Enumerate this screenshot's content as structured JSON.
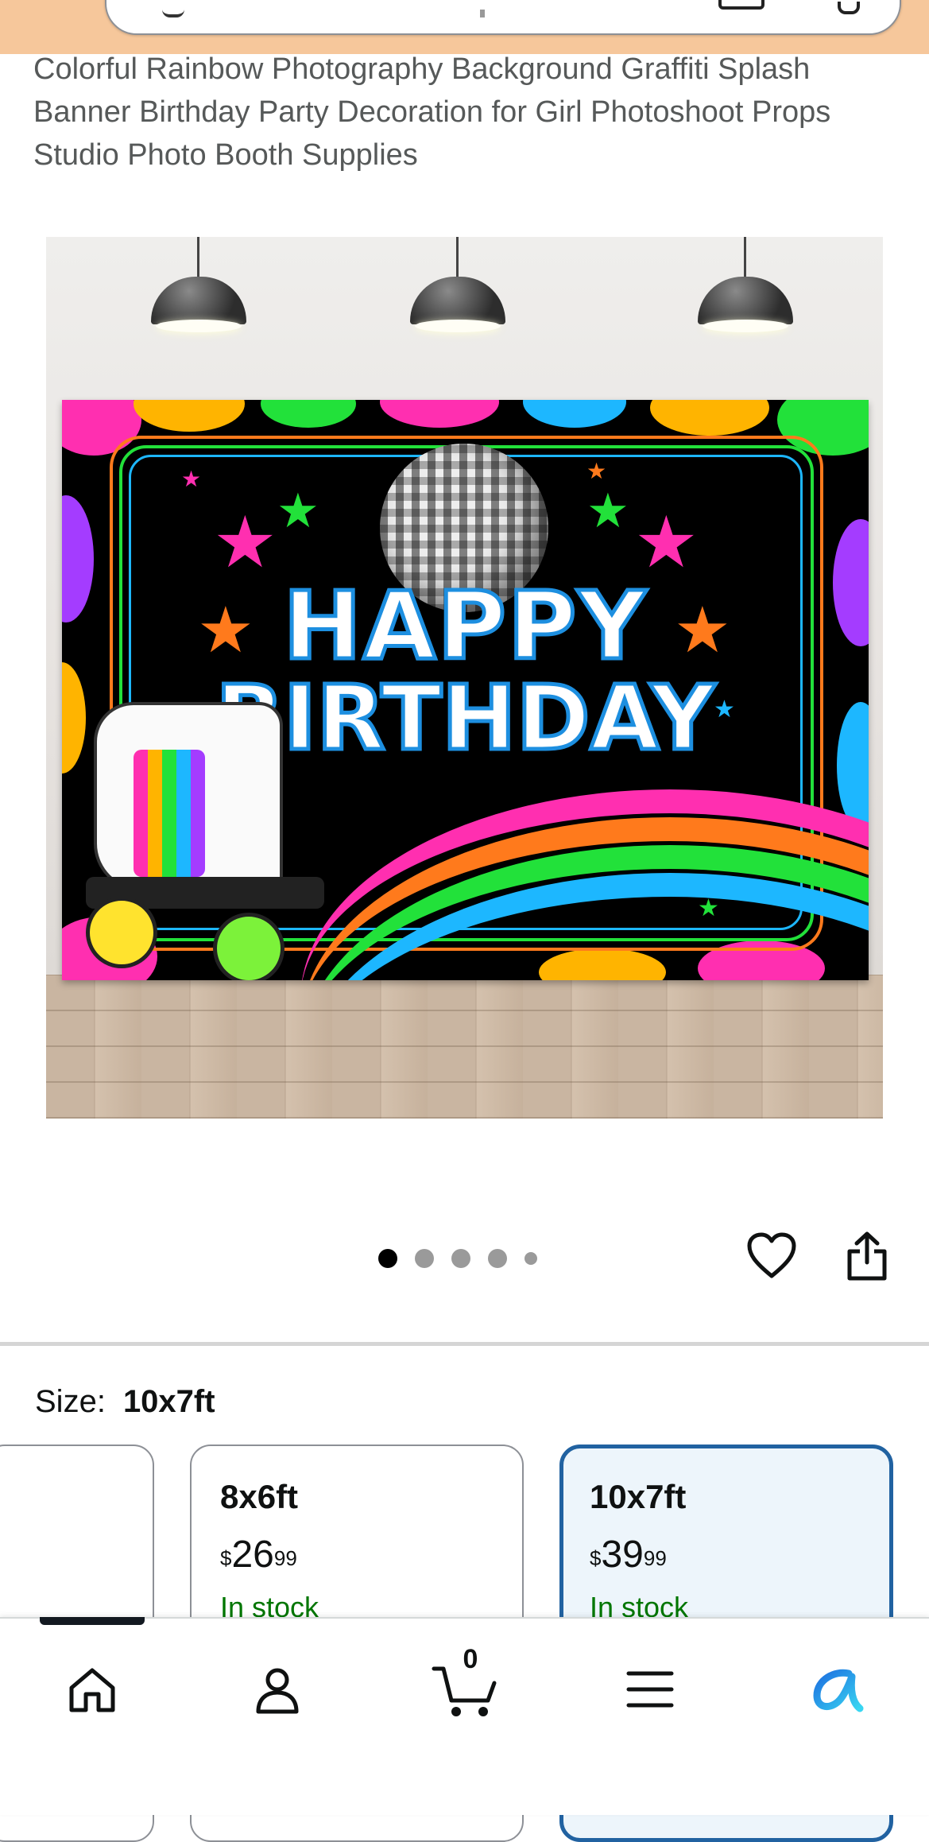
{
  "product": {
    "title": "Colorful Rainbow Photography Background Graffiti Splash Banner Birthday Party Decoration for Girl Photoshoot Props Studio Photo Booth Supplies"
  },
  "hero_image": {
    "text_line1": "HAPPY",
    "text_line2": "BIRTHDAY",
    "skate_brand": "Rainbow"
  },
  "carousel": {
    "total_dots": 5,
    "active_index": 0
  },
  "actions": {
    "favorite_icon": "heart-icon",
    "share_icon": "share-icon"
  },
  "size": {
    "label": "Size:",
    "selected": "10x7ft",
    "options": [
      {
        "name": "",
        "price_symbol": "",
        "price_whole": "",
        "price_fraction": "",
        "stock": ""
      },
      {
        "name": "8x6ft",
        "price_symbol": "$",
        "price_whole": "26",
        "price_fraction": "99",
        "stock": "In stock"
      },
      {
        "name": "10x7ft",
        "price_symbol": "$",
        "price_whole": "39",
        "price_fraction": "99",
        "stock": "In stock"
      }
    ]
  },
  "bottom_nav": {
    "items": [
      "home-icon",
      "account-icon",
      "cart-icon",
      "menu-icon",
      "rufus-icon"
    ],
    "cart_count": "0",
    "active_index": 0
  },
  "colors": {
    "header_bg": "#f6c79b",
    "selected_border": "#2162a1",
    "selected_bg": "#edf5fb",
    "in_stock": "#007600",
    "rufus_accent": "#1d8fe0"
  }
}
